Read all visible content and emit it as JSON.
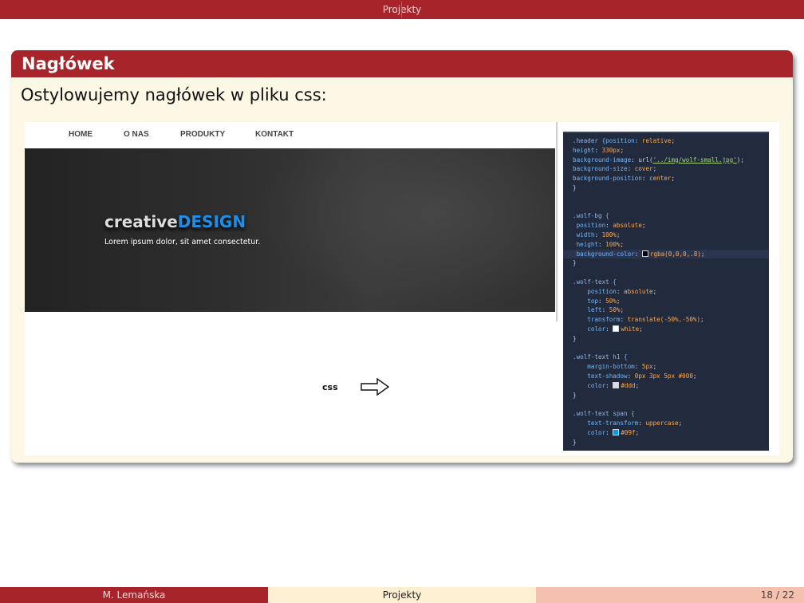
{
  "header": {
    "title": "Projekty"
  },
  "block": {
    "title": "Nagłówek",
    "text": "Ostylowujemy nagłówek w pliku css:"
  },
  "site": {
    "nav": [
      "HOME",
      "O NAS",
      "PRODUKTY",
      "KONTAKT"
    ],
    "hero_title_part1": "creative",
    "hero_title_part2": "DESIGN",
    "hero_subtitle": "Lorem ipsum dolor, sit amet consectetur."
  },
  "annotation": {
    "label": "css",
    "arrow_icon": "right-arrow-icon"
  },
  "code": {
    "lines": [
      ".header {position: relative;",
      "height: 330px;",
      "background-image: url('../img/wolf-small.jpg');",
      "background-size: cover;",
      "background-position: center;",
      "}",
      "",
      "",
      ".wolf-bg {",
      " position: absolute;",
      " width: 100%;",
      " height: 100%;",
      " background-color: rgba(0,0,0,.8);",
      "}",
      "",
      ".wolf-text {",
      "    position: absolute;",
      "    top: 50%;",
      "    left: 50%;",
      "    transform: translate(-50%,-50%);",
      "    color: white;",
      "}",
      "",
      ".wolf-text h1 {",
      "    margin-bottom: 5px;",
      "    text-shadow: 0px 3px 5px #000;",
      "    color: #ddd;",
      "}",
      "",
      ".wolf-text span {",
      "    text-transform: uppercase;",
      "    color: #09f;",
      "}"
    ],
    "swatch_colors": {
      "rgba": "#000000",
      "white": "#ffffff",
      "#000": "#000000",
      "#ddd": "#dddddd",
      "#09f": "#0099ff"
    }
  },
  "footer": {
    "author": "M. Lemańska",
    "title": "Projekty",
    "page": "18 / 22"
  },
  "colors": {
    "accent": "#a7242a",
    "block_bg": "#fdf7e6",
    "code_bg": "#222a3d"
  }
}
